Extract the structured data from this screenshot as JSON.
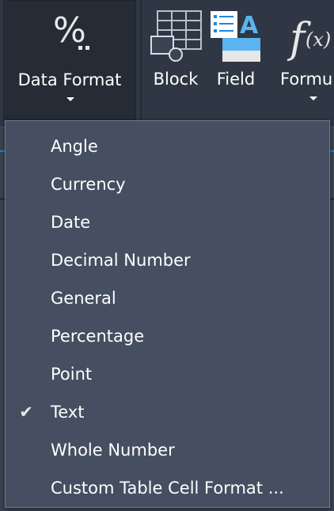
{
  "ribbon": {
    "data_format": {
      "label": "Data Format",
      "icon": "percent-format-icon"
    },
    "block": {
      "label": "Block",
      "icon": "block-table-icon"
    },
    "field": {
      "label": "Field",
      "icon": "field-list-icon"
    },
    "formula": {
      "label": "Formu",
      "icon": "formula-icon"
    }
  },
  "menu": {
    "items": [
      {
        "label": "Angle",
        "checked": false
      },
      {
        "label": "Currency",
        "checked": false
      },
      {
        "label": "Date",
        "checked": false
      },
      {
        "label": "Decimal Number",
        "checked": false
      },
      {
        "label": "General",
        "checked": false
      },
      {
        "label": "Percentage",
        "checked": false
      },
      {
        "label": "Point",
        "checked": false
      },
      {
        "label": "Text",
        "checked": true
      },
      {
        "label": "Whole Number",
        "checked": false
      },
      {
        "label": "Custom Table Cell Format ...",
        "checked": false
      }
    ],
    "check_glyph": "✔"
  },
  "colors": {
    "ribbon_bg": "#2f3744",
    "menu_bg": "#454f61",
    "accent_blue": "#2a7fc4",
    "field_icon_blue": "#5ab4f0"
  }
}
